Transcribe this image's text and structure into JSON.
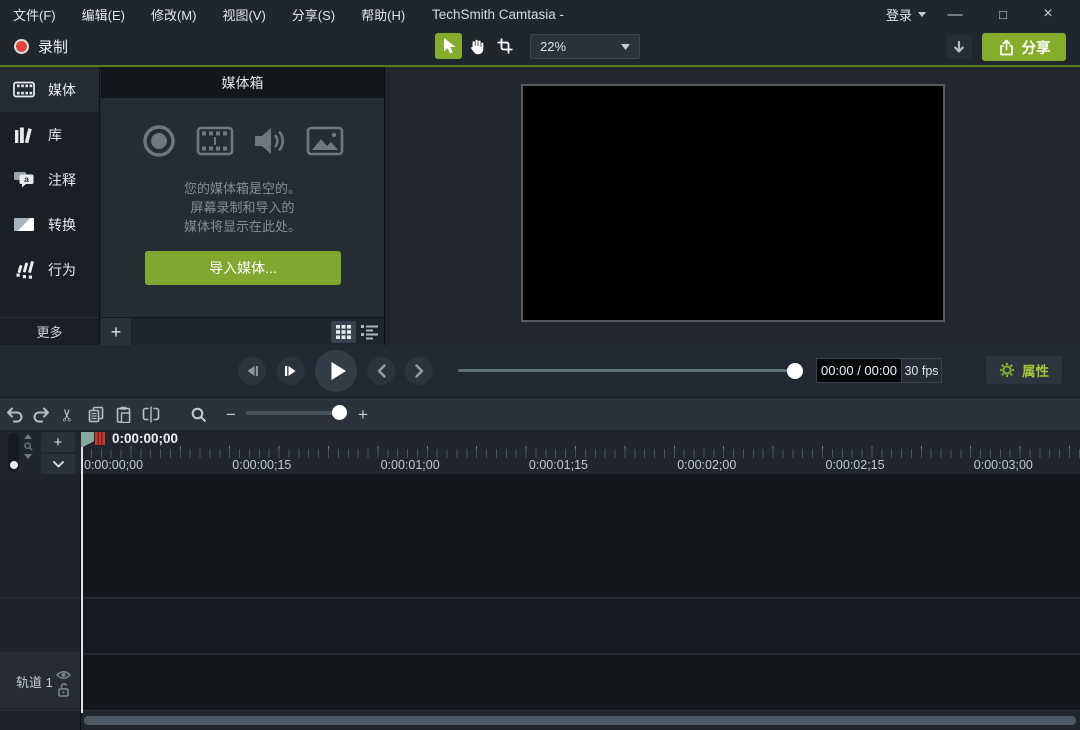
{
  "window": {
    "title": "TechSmith Camtasia -",
    "login": "登录",
    "minimize": "—",
    "maximize": "□",
    "close": "×"
  },
  "menu": {
    "items": [
      "文件(F)",
      "编辑(E)",
      "修改(M)",
      "视图(V)",
      "分享(S)",
      "帮助(H)"
    ]
  },
  "toolbar": {
    "record_label": "录制",
    "zoom_level": "22%",
    "share_label": "分享"
  },
  "sidebar": {
    "items": [
      "媒体",
      "库",
      "注释",
      "转换",
      "行为"
    ],
    "more_label": "更多"
  },
  "media_bin": {
    "title": "媒体箱",
    "empty_text": [
      "您的媒体箱是空的。",
      "屏幕录制和导入的",
      "媒体将显示在此处。"
    ],
    "import_label": "导入媒体...",
    "add_label": "+"
  },
  "playback": {
    "time_display": "00:00 / 00:00",
    "fps_display": "30 fps",
    "properties_label": "属性"
  },
  "timeline": {
    "add_track_label": "+",
    "playhead_time": "0:00:00;00",
    "ruler_labels": [
      "0:00:00;00",
      "0:00:00;15",
      "0:00:01;00",
      "0:00:01;15",
      "0:00:02;00",
      "0:00:02;15",
      "0:00:03;00"
    ],
    "tracks": [
      {
        "name": "轨道 1"
      }
    ]
  },
  "colors": {
    "accent_green": "#84ad2b",
    "record_red": "#e5443a",
    "playhead_flag": "#87a89f",
    "playhead_marker": "#c23b2e"
  }
}
